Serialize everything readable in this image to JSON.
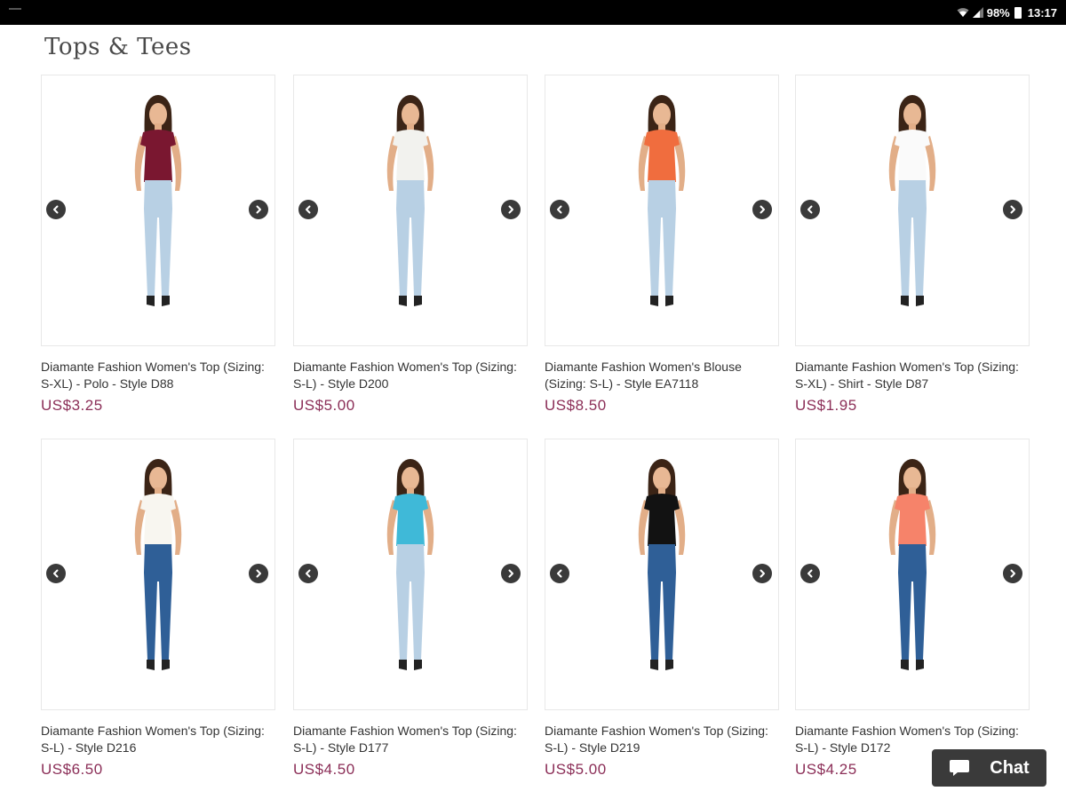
{
  "status_bar": {
    "battery": "98%",
    "time": "13:17"
  },
  "page": {
    "title": "Tops & Tees"
  },
  "products": [
    {
      "name": "Diamante Fashion Women's Top (Sizing: S-XL) - Polo - Style D88",
      "price": "US$3.25",
      "top_color": "#7a1730",
      "jeans_color": "#b8d0e4"
    },
    {
      "name": "Diamante Fashion Women's Top (Sizing: S-L) - Style D200",
      "price": "US$5.00",
      "top_color": "#f2f2ee",
      "jeans_color": "#b8d0e4"
    },
    {
      "name": "Diamante Fashion Women's Blouse (Sizing: S-L) - Style EA7118",
      "price": "US$8.50",
      "top_color": "#f06d3e",
      "jeans_color": "#b8d0e4"
    },
    {
      "name": "Diamante Fashion Women's Top (Sizing: S-XL) - Shirt - Style D87",
      "price": "US$1.95",
      "top_color": "#fafafa",
      "jeans_color": "#b8d0e4"
    },
    {
      "name": "Diamante Fashion Women's Top (Sizing: S-L) - Style D216",
      "price": "US$6.50",
      "top_color": "#f8f6f0",
      "jeans_color": "#2f5f97"
    },
    {
      "name": "Diamante Fashion Women's Top (Sizing: S-L) - Style D177",
      "price": "US$4.50",
      "top_color": "#3fb9d8",
      "jeans_color": "#b8d0e4"
    },
    {
      "name": "Diamante Fashion Women's Top (Sizing: S-L) - Style D219",
      "price": "US$5.00",
      "top_color": "#121212",
      "jeans_color": "#2f5f97"
    },
    {
      "name": "Diamante Fashion Women's Top (Sizing: S-L) - Style D172",
      "price": "US$4.25",
      "top_color": "#f6836a",
      "jeans_color": "#2f5f97"
    }
  ],
  "chat": {
    "label": "Chat"
  },
  "colors": {
    "price": "#8b2e57",
    "arrow_bg": "#3a3a3a",
    "chat_bg": "#3a3a3a"
  },
  "icons": {
    "carousel_prev": "chevron-left-icon",
    "carousel_next": "chevron-right-icon",
    "chat": "chat-bubble-icon"
  }
}
